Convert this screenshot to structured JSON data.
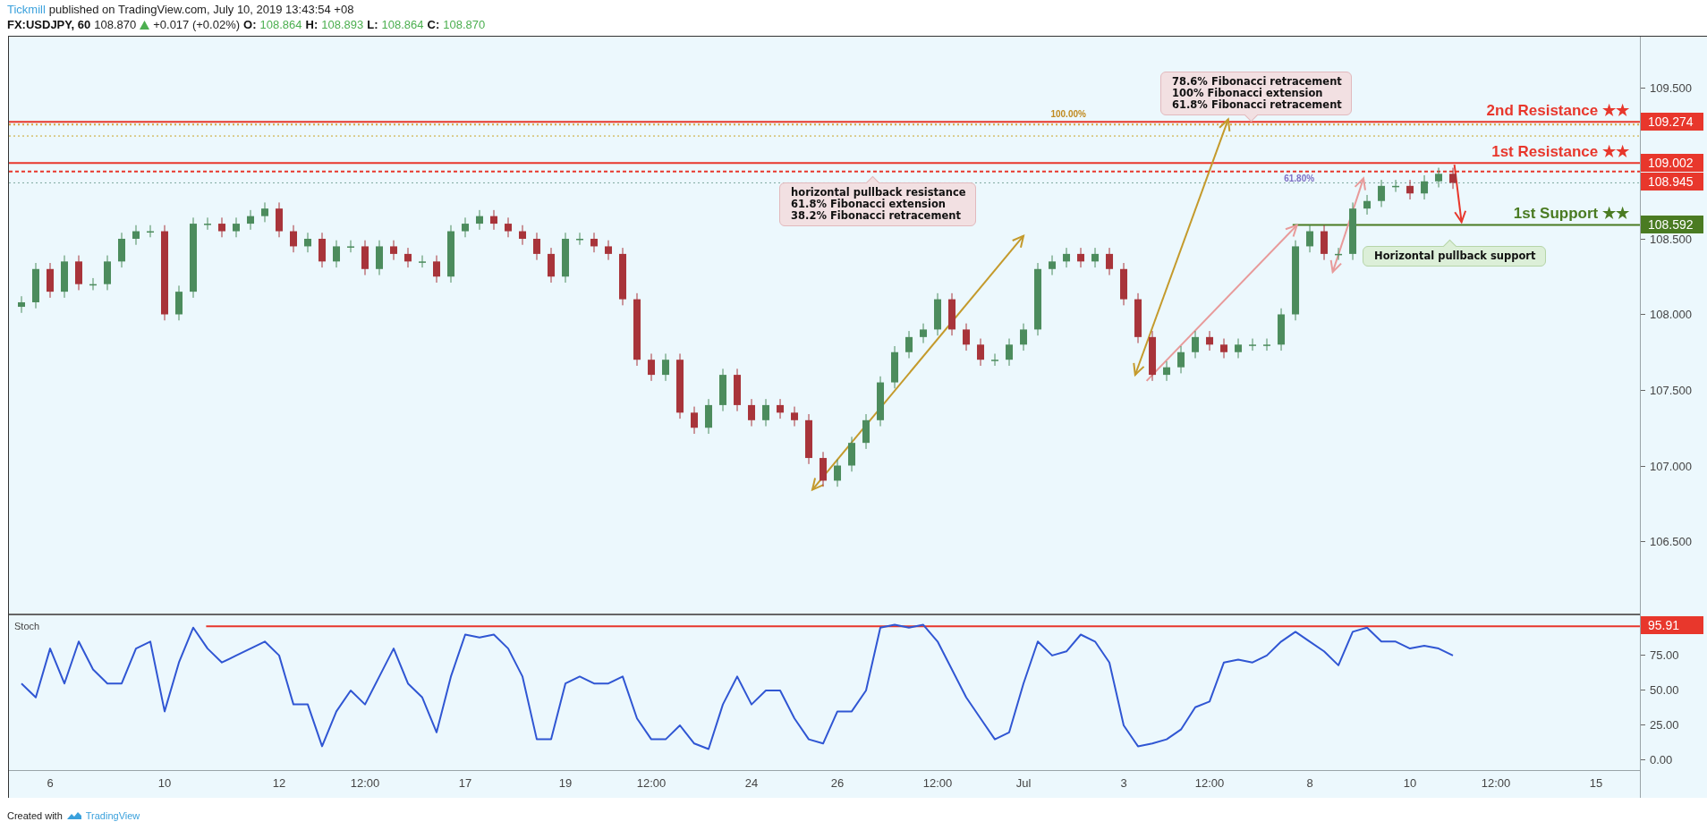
{
  "header": {
    "author": "Tickmill",
    "published": "published on TradingView.com, July 10, 2019 13:43:54 +08"
  },
  "symbol_bar": {
    "symbol": "FX:USDJPY, 60",
    "last": "108.870",
    "rising": true,
    "change": "+0.017 (+0.02%)",
    "ohlc": [
      {
        "label": "O:",
        "value": "108.864"
      },
      {
        "label": "H:",
        "value": "108.893"
      },
      {
        "label": "L:",
        "value": "108.864"
      },
      {
        "label": "C:",
        "value": "108.870"
      }
    ]
  },
  "price_pane": {
    "chart_data": {
      "type": "candlestick",
      "ylim": [
        106.015,
        109.837
      ],
      "yticks": [
        {
          "value": 109.5,
          "label": "109.500"
        },
        {
          "value": 108.5,
          "label": "108.500"
        },
        {
          "value": 108.0,
          "label": "108.000"
        },
        {
          "value": 107.5,
          "label": "107.500"
        },
        {
          "value": 107.0,
          "label": "107.000"
        },
        {
          "value": 106.5,
          "label": "106.500"
        }
      ],
      "ohlc": [
        [
          108.05,
          108.12,
          108.01,
          108.08
        ],
        [
          108.08,
          108.34,
          108.04,
          108.3
        ],
        [
          108.3,
          108.34,
          108.11,
          108.15
        ],
        [
          108.15,
          108.39,
          108.11,
          108.35
        ],
        [
          108.35,
          108.39,
          108.16,
          108.2
        ],
        [
          108.2,
          108.24,
          108.16,
          108.2
        ],
        [
          108.2,
          108.39,
          108.16,
          108.35
        ],
        [
          108.35,
          108.54,
          108.31,
          108.5
        ],
        [
          108.5,
          108.59,
          108.46,
          108.55
        ],
        [
          108.55,
          108.59,
          108.51,
          108.55
        ],
        [
          108.55,
          108.59,
          107.96,
          108.0
        ],
        [
          108.0,
          108.19,
          107.96,
          108.15
        ],
        [
          108.15,
          108.64,
          108.11,
          108.6
        ],
        [
          108.6,
          108.64,
          108.56,
          108.6
        ],
        [
          108.6,
          108.64,
          108.51,
          108.55
        ],
        [
          108.55,
          108.64,
          108.51,
          108.6
        ],
        [
          108.6,
          108.69,
          108.56,
          108.65
        ],
        [
          108.65,
          108.74,
          108.61,
          108.7
        ],
        [
          108.7,
          108.74,
          108.51,
          108.55
        ],
        [
          108.55,
          108.59,
          108.41,
          108.45
        ],
        [
          108.45,
          108.54,
          108.41,
          108.5
        ],
        [
          108.5,
          108.54,
          108.31,
          108.35
        ],
        [
          108.35,
          108.49,
          108.31,
          108.45
        ],
        [
          108.45,
          108.49,
          108.41,
          108.45
        ],
        [
          108.45,
          108.49,
          108.26,
          108.3
        ],
        [
          108.3,
          108.49,
          108.26,
          108.45
        ],
        [
          108.45,
          108.49,
          108.36,
          108.4
        ],
        [
          108.4,
          108.44,
          108.31,
          108.35
        ],
        [
          108.35,
          108.39,
          108.31,
          108.35
        ],
        [
          108.35,
          108.39,
          108.21,
          108.25
        ],
        [
          108.25,
          108.59,
          108.21,
          108.55
        ],
        [
          108.55,
          108.64,
          108.51,
          108.6
        ],
        [
          108.6,
          108.69,
          108.56,
          108.65
        ],
        [
          108.65,
          108.69,
          108.56,
          108.6
        ],
        [
          108.6,
          108.64,
          108.51,
          108.55
        ],
        [
          108.55,
          108.59,
          108.46,
          108.5
        ],
        [
          108.5,
          108.54,
          108.36,
          108.4
        ],
        [
          108.4,
          108.44,
          108.21,
          108.25
        ],
        [
          108.25,
          108.54,
          108.21,
          108.5
        ],
        [
          108.5,
          108.54,
          108.46,
          108.5
        ],
        [
          108.5,
          108.54,
          108.41,
          108.45
        ],
        [
          108.45,
          108.49,
          108.36,
          108.4
        ],
        [
          108.4,
          108.44,
          108.06,
          108.1
        ],
        [
          108.1,
          108.14,
          107.66,
          107.7
        ],
        [
          107.7,
          107.74,
          107.56,
          107.6
        ],
        [
          107.6,
          107.74,
          107.56,
          107.7
        ],
        [
          107.7,
          107.74,
          107.31,
          107.35
        ],
        [
          107.35,
          107.39,
          107.21,
          107.25
        ],
        [
          107.25,
          107.44,
          107.21,
          107.4
        ],
        [
          107.4,
          107.64,
          107.36,
          107.6
        ],
        [
          107.6,
          107.64,
          107.36,
          107.4
        ],
        [
          107.4,
          107.44,
          107.26,
          107.3
        ],
        [
          107.3,
          107.44,
          107.26,
          107.4
        ],
        [
          107.4,
          107.44,
          107.31,
          107.35
        ],
        [
          107.35,
          107.39,
          107.26,
          107.3
        ],
        [
          107.3,
          107.34,
          107.01,
          107.05
        ],
        [
          107.05,
          107.09,
          106.86,
          106.9
        ],
        [
          106.9,
          107.04,
          106.86,
          107.0
        ],
        [
          107.0,
          107.19,
          106.96,
          107.15
        ],
        [
          107.15,
          107.34,
          107.11,
          107.3
        ],
        [
          107.3,
          107.59,
          107.26,
          107.55
        ],
        [
          107.55,
          107.79,
          107.51,
          107.75
        ],
        [
          107.75,
          107.89,
          107.71,
          107.85
        ],
        [
          107.85,
          107.94,
          107.81,
          107.9
        ],
        [
          107.9,
          108.14,
          107.86,
          108.1
        ],
        [
          108.1,
          108.14,
          107.86,
          107.9
        ],
        [
          107.9,
          107.94,
          107.76,
          107.8
        ],
        [
          107.8,
          107.84,
          107.66,
          107.7
        ],
        [
          107.7,
          107.74,
          107.66,
          107.7
        ],
        [
          107.7,
          107.84,
          107.66,
          107.8
        ],
        [
          107.8,
          107.94,
          107.76,
          107.9
        ],
        [
          107.9,
          108.34,
          107.86,
          108.3
        ],
        [
          108.3,
          108.39,
          108.26,
          108.35
        ],
        [
          108.35,
          108.44,
          108.31,
          108.4
        ],
        [
          108.4,
          108.44,
          108.31,
          108.35
        ],
        [
          108.35,
          108.44,
          108.31,
          108.4
        ],
        [
          108.4,
          108.44,
          108.26,
          108.3
        ],
        [
          108.3,
          108.34,
          108.06,
          108.1
        ],
        [
          108.1,
          108.14,
          107.81,
          107.85
        ],
        [
          107.85,
          107.89,
          107.56,
          107.6
        ],
        [
          107.6,
          107.69,
          107.56,
          107.65
        ],
        [
          107.65,
          107.79,
          107.61,
          107.75
        ],
        [
          107.75,
          107.89,
          107.71,
          107.85
        ],
        [
          107.85,
          107.89,
          107.76,
          107.8
        ],
        [
          107.8,
          107.84,
          107.71,
          107.75
        ],
        [
          107.75,
          107.84,
          107.71,
          107.8
        ],
        [
          107.8,
          107.84,
          107.76,
          107.8
        ],
        [
          107.8,
          107.84,
          107.76,
          107.8
        ],
        [
          107.8,
          108.04,
          107.76,
          108.0
        ],
        [
          108.0,
          108.49,
          107.96,
          108.45
        ],
        [
          108.45,
          108.59,
          108.41,
          108.55
        ],
        [
          108.55,
          108.59,
          108.36,
          108.4
        ],
        [
          108.4,
          108.44,
          108.36,
          108.4
        ],
        [
          108.4,
          108.74,
          108.36,
          108.7
        ],
        [
          108.7,
          108.79,
          108.66,
          108.75
        ],
        [
          108.75,
          108.89,
          108.71,
          108.85
        ],
        [
          108.85,
          108.89,
          108.81,
          108.85
        ],
        [
          108.85,
          108.89,
          108.76,
          108.8
        ],
        [
          108.8,
          108.92,
          108.76,
          108.88
        ],
        [
          108.88,
          108.97,
          108.84,
          108.93
        ],
        [
          108.93,
          108.97,
          108.83,
          108.87
        ],
        null,
        null,
        null,
        null,
        null,
        null,
        null,
        null,
        null,
        null
      ],
      "ref_lines": [
        {
          "axis": "y",
          "value": 109.274,
          "label": "2nd Resistance ★★",
          "color": "#e8372c"
        },
        {
          "axis": "y",
          "value": 109.255,
          "color": "#d9a441"
        },
        {
          "axis": "y",
          "value": 109.18,
          "color": "#c9a227"
        },
        {
          "axis": "y",
          "value": 109.002,
          "label": "1st Resistance ★★",
          "color": "#e8372c"
        },
        {
          "axis": "y",
          "value": 108.945,
          "color": "#e8372c"
        },
        {
          "axis": "y",
          "value": 108.87,
          "color": "#7fa8a0"
        },
        {
          "axis": "y",
          "value": 108.592,
          "label": "1st Support ★★",
          "color": "#4a7b22"
        }
      ]
    },
    "price_tags": [
      {
        "text": "109.274",
        "color": "#e8372c"
      },
      {
        "text": "109.002",
        "color": "#e8372c"
      },
      {
        "text": "108.945",
        "color": "#e8372c"
      },
      {
        "text": "108.592",
        "color": "#4a7b22"
      }
    ],
    "fib_labels": [
      {
        "text": "100.00%",
        "color": "#c08a1e"
      },
      {
        "text": "61.80%",
        "color": "#7d6fc4"
      }
    ],
    "callouts": [
      {
        "color": "#f2e0e2",
        "lines": [
          "horizontal pullback resistance",
          "61.8% Fibonacci extension",
          "38.2% Fibonacci retracement"
        ]
      },
      {
        "color": "#f2e0e2",
        "lines": [
          "78.6% Fibonacci retracement",
          "100% Fibonacci extension",
          "61.8% Fibonacci retracement"
        ]
      },
      {
        "color": "#dcefd8",
        "lines": [
          "Horizontal pullback support"
        ]
      }
    ]
  },
  "stoch_pane": {
    "chart_data": {
      "type": "line",
      "ylim": [
        -7.7,
        103.8
      ],
      "yticks": [
        {
          "value": 75,
          "label": "75.00"
        },
        {
          "value": 50,
          "label": "50.00"
        },
        {
          "value": 25,
          "label": "25.00"
        },
        {
          "value": 0,
          "label": "0.00"
        }
      ],
      "categories": [
        null,
        null,
        "6",
        null,
        null,
        null,
        null,
        null,
        null,
        null,
        "10",
        null,
        null,
        null,
        null,
        null,
        null,
        null,
        "12",
        null,
        null,
        null,
        null,
        null,
        "12:00",
        null,
        null,
        null,
        null,
        null,
        null,
        "17",
        null,
        null,
        null,
        null,
        null,
        null,
        "19",
        null,
        null,
        null,
        null,
        null,
        "12:00",
        null,
        null,
        null,
        null,
        null,
        null,
        "24",
        null,
        null,
        null,
        null,
        null,
        "26",
        null,
        null,
        null,
        null,
        null,
        null,
        "12:00",
        null,
        null,
        null,
        null,
        null,
        "Jul",
        null,
        null,
        null,
        null,
        null,
        null,
        "3",
        null,
        null,
        null,
        null,
        null,
        "12:00",
        null,
        null,
        null,
        null,
        null,
        null,
        "8",
        null,
        null,
        null,
        null,
        null,
        null,
        "10",
        null,
        null,
        null,
        null,
        null,
        "12:00",
        null,
        null,
        null,
        null,
        null,
        null,
        "15"
      ],
      "series": [
        {
          "name": "Stoch",
          "color": "#3056d3",
          "values": [
            55,
            45,
            80,
            55,
            85,
            65,
            55,
            55,
            80,
            85,
            35,
            70,
            95,
            80,
            70,
            75,
            80,
            85,
            75,
            40,
            40,
            10,
            35,
            50,
            40,
            60,
            80,
            55,
            45,
            20,
            60,
            90,
            88,
            90,
            80,
            60,
            15,
            15,
            55,
            60,
            55,
            55,
            60,
            30,
            15,
            15,
            25,
            12,
            8,
            40,
            60,
            40,
            50,
            50,
            30,
            15,
            12,
            35,
            35,
            50,
            95,
            97,
            95,
            97,
            85,
            65,
            45,
            30,
            15,
            20,
            55,
            85,
            75,
            78,
            90,
            85,
            70,
            25,
            10,
            12,
            15,
            22,
            38,
            42,
            70,
            72,
            70,
            75,
            85,
            92,
            85,
            78,
            68,
            92,
            95,
            85,
            85,
            80,
            82,
            80,
            75,
            null,
            null,
            null,
            null,
            null,
            null,
            null,
            null,
            null,
            null
          ]
        }
      ],
      "ref_lines": [
        {
          "axis": "y",
          "value": 95.91,
          "color": "#e8372c"
        }
      ]
    },
    "price_tags": [
      {
        "text": "95.91",
        "color": "#e8372c"
      }
    ]
  },
  "footer": {
    "text": "Created with",
    "brand": "TradingView"
  }
}
